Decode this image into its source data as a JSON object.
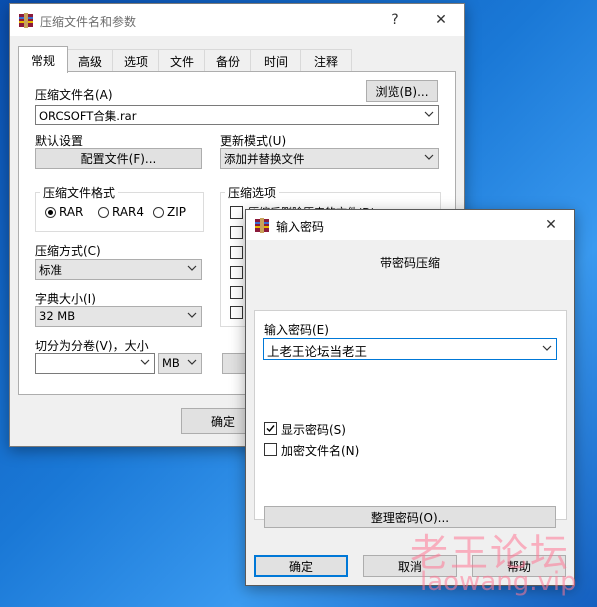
{
  "colors": {
    "desktop": "#1a78d6",
    "accent": "#0078d7",
    "watermark": "#ff7896"
  },
  "main_window": {
    "title": "压缩文件名和参数",
    "help_glyph": "?",
    "close_glyph": "✕",
    "tabs": [
      "常规",
      "高级",
      "选项",
      "文件",
      "备份",
      "时间",
      "注释"
    ],
    "archive_name_label": "压缩文件名(A)",
    "browse_button": "浏览(B)...",
    "archive_name_value": "ORCSOFT合集.rar",
    "default_settings_label": "默认设置",
    "profiles_button": "配置文件(F)...",
    "update_mode_label": "更新模式(U)",
    "update_mode_value": "添加并替换文件",
    "format_group": "压缩文件格式",
    "formats": [
      "RAR",
      "RAR4",
      "ZIP"
    ],
    "selected_format": "RAR",
    "options_group": "压缩选项",
    "options_visible_first": "压缩后删除原来的文件(D)",
    "method_label": "压缩方式(C)",
    "method_value": "标准",
    "dict_label": "字典大小(I)",
    "dict_value": "32 MB",
    "split_label": "切分为分卷(V)，大小",
    "split_value": "",
    "split_unit": "MB",
    "ok_button": "确定"
  },
  "password_dialog": {
    "title": "输入密码",
    "close_glyph": "✕",
    "heading": "带密码压缩",
    "enter_label": "输入密码(E)",
    "password_value": "上老王论坛当老王",
    "show_password_label": "显示密码(S)",
    "show_password_checked": true,
    "encrypt_names_label": "加密文件名(N)",
    "encrypt_names_checked": false,
    "organize_button": "整理密码(O)...",
    "ok_button": "确定",
    "cancel_button": "取消",
    "help_button": "帮助"
  },
  "watermark": {
    "line1": "老王论坛",
    "line2": "laowang.vip"
  }
}
